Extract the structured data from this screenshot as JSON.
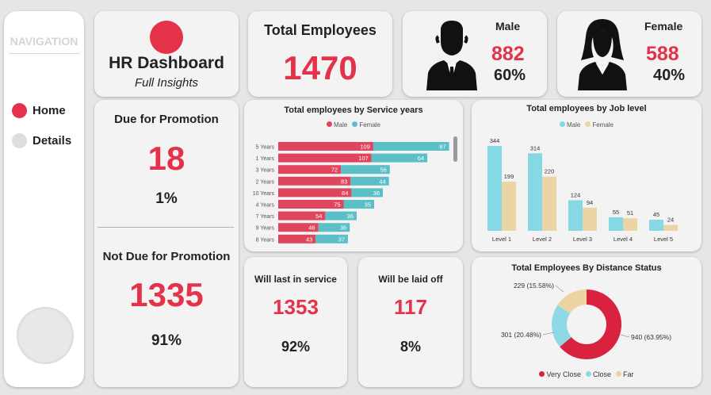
{
  "colors": {
    "male": "#e0455e",
    "female": "#5bbfc8",
    "level_male": "#86d8e4",
    "level_female": "#ecd5a5",
    "very_close": "#d8223f",
    "close": "#8fd9e6",
    "far": "#ecd3a0",
    "accent": "#e3324a"
  },
  "nav": {
    "title": "NAVIGATION",
    "home": "Home",
    "details": "Details"
  },
  "header": {
    "title": "HR Dashboard",
    "subtitle": "Full Insights"
  },
  "total": {
    "label": "Total Employees",
    "value": "1470"
  },
  "male": {
    "label": "Male",
    "value": "882",
    "pct": "60%"
  },
  "female": {
    "label": "Female",
    "value": "588",
    "pct": "40%"
  },
  "promotion": {
    "due_label": "Due for Promotion",
    "due_value": "18",
    "due_pct": "1%",
    "not_due_label": "Not Due for Promotion",
    "not_due_value": "1335",
    "not_due_pct": "91%"
  },
  "service": {
    "label": "Will last in service",
    "value": "1353",
    "pct": "92%"
  },
  "laid_off": {
    "label": "Will be laid off",
    "value": "117",
    "pct": "8%"
  },
  "chart_data": [
    {
      "type": "bar",
      "orientation": "horizontal-stacked",
      "title": "Total employees by Service years",
      "categories": [
        "5 Years",
        "1 Years",
        "3 Years",
        "2 Years",
        "10 Years",
        "4 Years",
        "7 Years",
        "9 Years",
        "8 Years"
      ],
      "series": [
        {
          "name": "Male",
          "values": [
            109,
            107,
            72,
            83,
            84,
            75,
            54,
            46,
            43
          ]
        },
        {
          "name": "Female",
          "values": [
            87,
            64,
            56,
            44,
            36,
            35,
            36,
            36,
            37
          ]
        }
      ]
    },
    {
      "type": "bar",
      "title": "Total employees by Job level",
      "categories": [
        "Level 1",
        "Level 2",
        "Level 3",
        "Level 4",
        "Level 5"
      ],
      "series": [
        {
          "name": "Male",
          "values": [
            344,
            314,
            124,
            55,
            45
          ]
        },
        {
          "name": "Female",
          "values": [
            199,
            220,
            94,
            51,
            24
          ]
        }
      ]
    },
    {
      "type": "pie",
      "subtype": "donut",
      "title": "Total Employees By Distance Status",
      "categories": [
        "Very Close",
        "Close",
        "Far"
      ],
      "values": [
        940,
        301,
        229
      ],
      "labels": [
        "940 (63.95%)",
        "301 (20.48%)",
        "229 (15.58%)"
      ]
    }
  ]
}
